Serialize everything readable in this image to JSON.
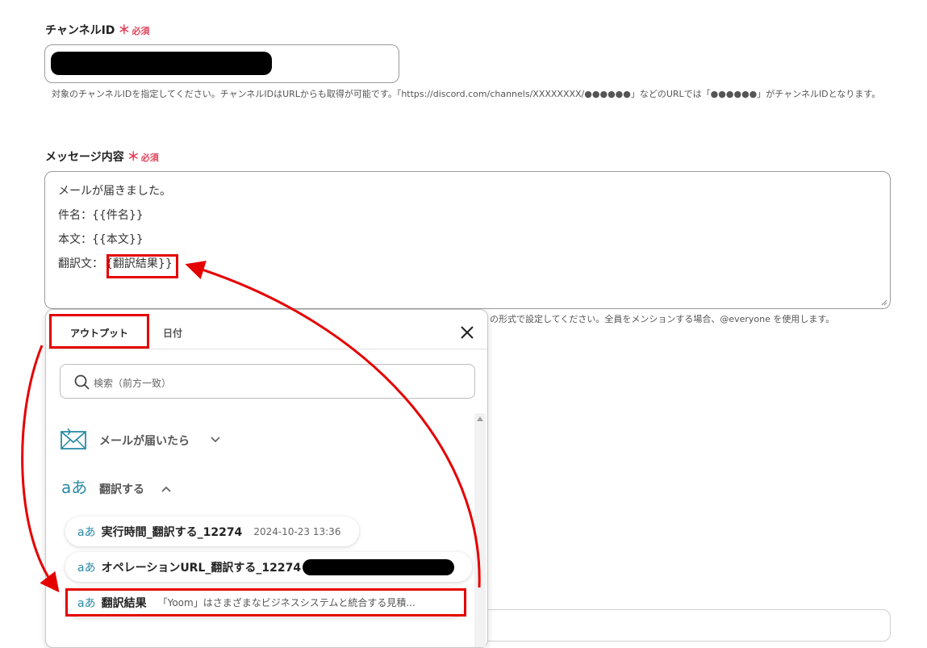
{
  "channel_field": {
    "label": "チャンネルID",
    "required_mark": "＊",
    "required_text": "必須",
    "help": "対象のチャンネルIDを指定してください。チャンネルIDはURLからも取得が可能です。「https://discord.com/channels/XXXXXXXX/●●●●●●」などのURLでは「●●●●●●」がチャンネルIDとなります。"
  },
  "message_field": {
    "label": "メッセージ内容",
    "required_mark": "＊",
    "required_text": "必須",
    "lines": {
      "line1": "メールが届きました。",
      "line2": "件名：{{件名}}",
      "line3": "本文：{{本文}}",
      "line4_prefix": "翻訳文：",
      "line4_var": "{翻訳結果}}"
    },
    "help_partial": "の形式で設定してください。全員をメンションする場合、@everyone を使用します。"
  },
  "popup": {
    "tabs": {
      "output": "アウトプット",
      "date": "日付"
    },
    "search_placeholder": "検索（前方一致）",
    "sections": {
      "mail": "メールが届いたら",
      "translate": "翻訳する"
    },
    "items": {
      "exec_time": {
        "title": "実行時間_翻訳する_12274",
        "value": "2024-10-23 13:36"
      },
      "op_url": {
        "title": "オペレーションURL_翻訳する_12274"
      },
      "result": {
        "title": "翻訳結果",
        "value": "「Yoom」はさまざまなビジネスシステムと統合する見積..."
      }
    }
  },
  "colors": {
    "required": "#e0455b",
    "annotation": "#e50000",
    "icon_teal": "#2b8aa8"
  }
}
